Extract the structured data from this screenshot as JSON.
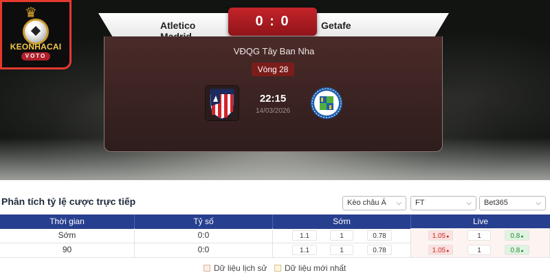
{
  "brand": {
    "name": "KEONHACAI",
    "sub": "VOTO"
  },
  "match": {
    "home_team": "Atletico Madrid",
    "away_team": "Getafe",
    "score": "0 : 0",
    "league": "VĐQG Tây Ban Nha",
    "round": "Vòng 28",
    "kickoff_time": "22:15",
    "kickoff_date": "14/03/2026"
  },
  "odds_section": {
    "title": "Phân tích tỷ lệ cược trực tiếp",
    "filters": {
      "odds_type": "Kèo châu Á",
      "period": "FT",
      "bookmaker": "Bet365"
    },
    "columns": [
      "Thời gian",
      "Tỷ số",
      "Sớm",
      "Live"
    ],
    "rows": [
      {
        "time": "Sớm",
        "score": "0:0",
        "early": [
          "1.1",
          "1",
          "0.78"
        ],
        "live": [
          "1.05",
          "1",
          "0.8"
        ]
      },
      {
        "time": "90",
        "score": "0:0",
        "early": [
          "1.1",
          "1",
          "0.78"
        ],
        "live": [
          "1.05",
          "1",
          "0.8"
        ]
      }
    ],
    "legend": [
      "Dữ liệu lịch sử",
      "Dữ liệu mới nhất"
    ]
  },
  "colors": {
    "accent_red": "#c4242a",
    "table_header": "#273f8f",
    "odds_down": "#c0312b",
    "odds_up": "#2c8a3a"
  },
  "icons": {
    "odds_down": "arrow-down-icon",
    "odds_up": "arrow-up-icon",
    "dropdown": "chevron-down-icon"
  }
}
